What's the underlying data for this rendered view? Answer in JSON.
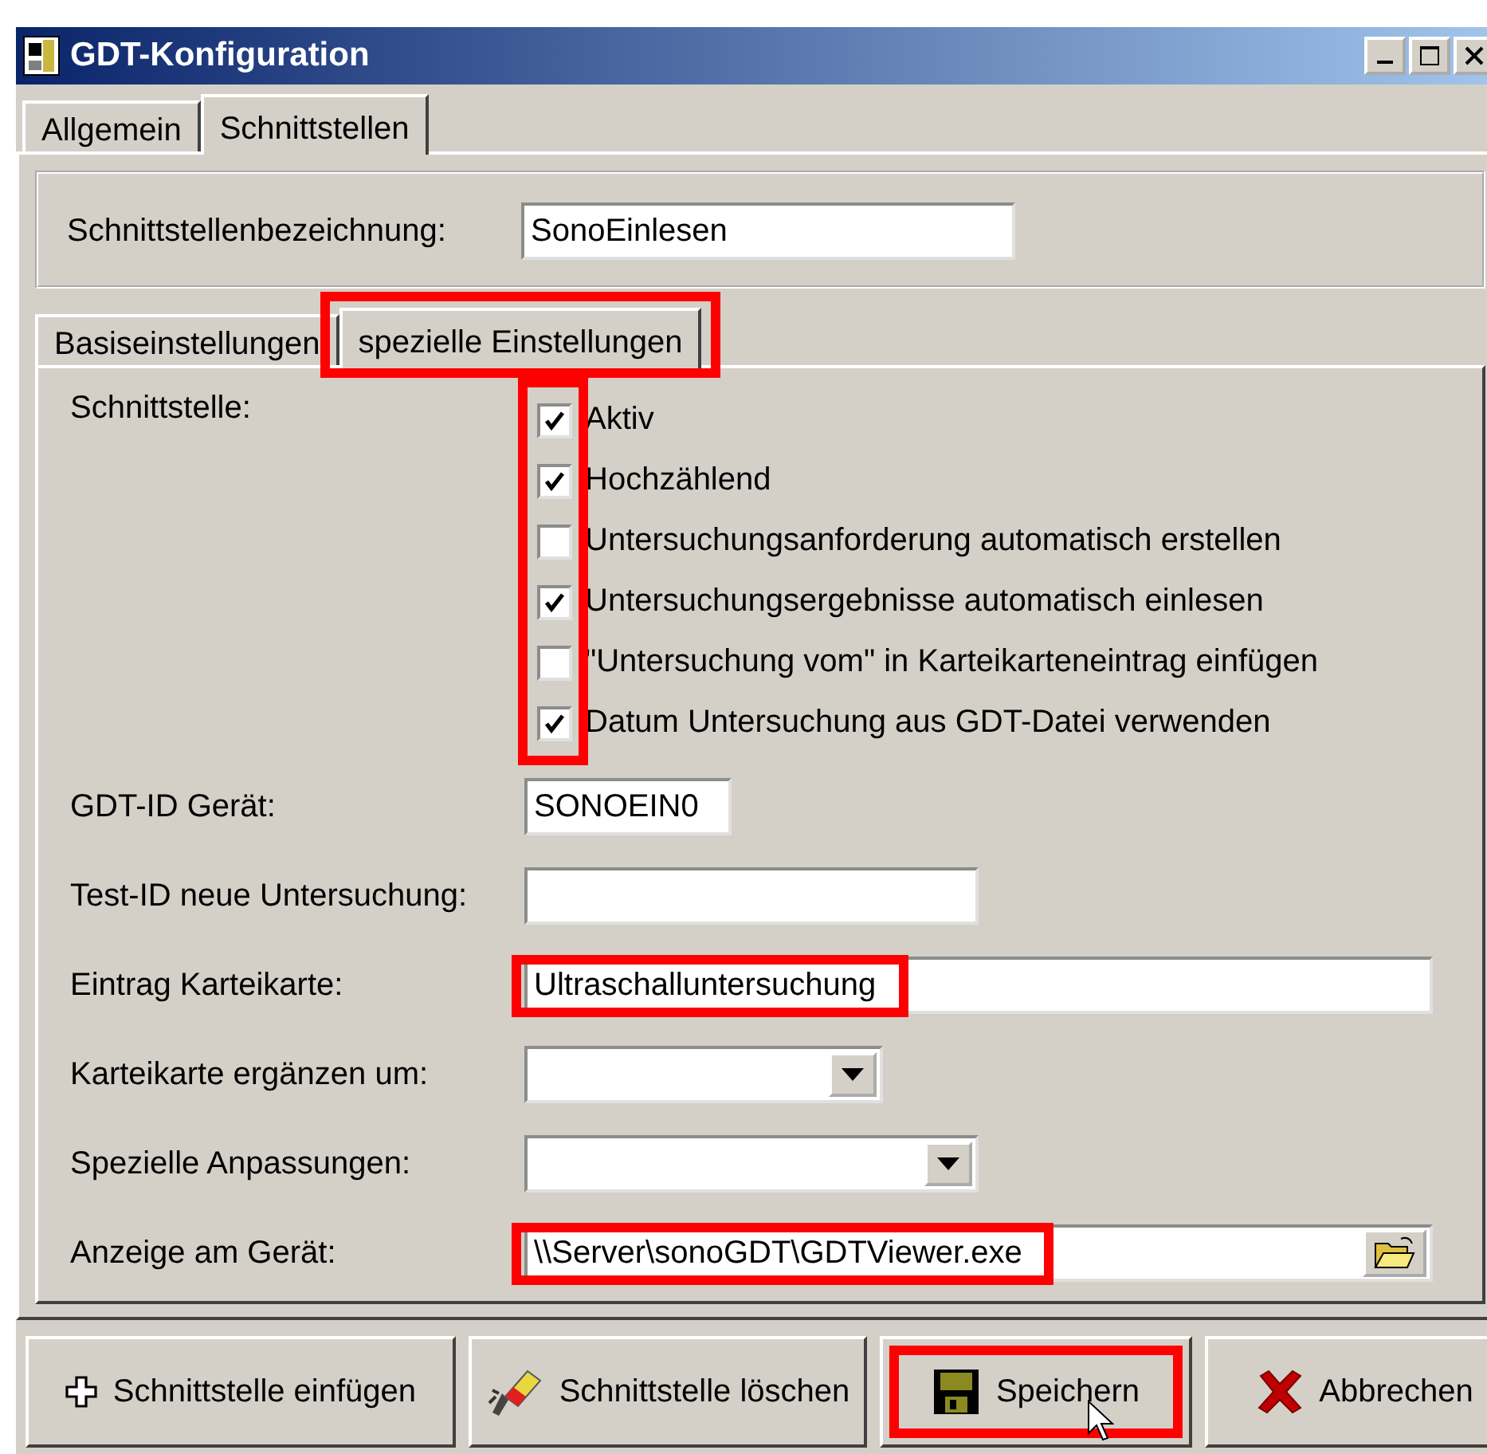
{
  "window": {
    "title": "GDT-Konfiguration"
  },
  "tabs": [
    {
      "label": "Allgemein",
      "selected": false
    },
    {
      "label": "Schnittstellen",
      "selected": true
    }
  ],
  "name_field": {
    "label": "Schnittstellenbezeichnung:",
    "value": "SonoEinlesen"
  },
  "subtabs": [
    {
      "label": "Basiseinstellungen",
      "selected": false,
      "highlighted": false
    },
    {
      "label": "spezielle Einstellungen",
      "selected": true,
      "highlighted": true
    }
  ],
  "schnittstelle": {
    "label": "Schnittstelle:",
    "highlighted": true,
    "options": [
      {
        "label": "Aktiv",
        "checked": true
      },
      {
        "label": "Hochzählend",
        "checked": true
      },
      {
        "label": "Untersuchungsanforderung automatisch erstellen",
        "checked": false
      },
      {
        "label": "Untersuchungsergebnisse automatisch einlesen",
        "checked": true
      },
      {
        "label": "\"Untersuchung vom\" in Karteikarteneintrag einfügen",
        "checked": false
      },
      {
        "label": "Datum Untersuchung aus GDT-Datei verwenden",
        "checked": true
      }
    ]
  },
  "fields": [
    {
      "kind": "text",
      "label": "GDT-ID Gerät:",
      "value": "SONOEIN0",
      "highlighted": false
    },
    {
      "kind": "text",
      "label": "Test-ID neue Untersuchung:",
      "highlighted": false
    },
    {
      "kind": "text",
      "label": "Eintrag Karteikarte:",
      "value": "Ultraschalluntersuchung",
      "highlighted": true
    },
    {
      "kind": "dropdown",
      "label": "Karteikarte ergänzen um:",
      "highlighted": false
    },
    {
      "kind": "dropdown",
      "label": "Spezielle Anpassungen:",
      "highlighted": false
    },
    {
      "kind": "file",
      "label": "Anzeige am Gerät:",
      "value": "\\\\Server\\sonoGDT\\GDTViewer.exe",
      "highlighted": true
    }
  ],
  "buttons": [
    {
      "kind": "add",
      "label": "Schnittstelle einfügen",
      "highlighted": false
    },
    {
      "kind": "delete",
      "label": "Schnittstelle löschen",
      "highlighted": false
    },
    {
      "kind": "save",
      "label": "Speichern",
      "highlighted": true
    },
    {
      "kind": "cancel",
      "label": "Abbrechen",
      "highlighted": false
    }
  ]
}
